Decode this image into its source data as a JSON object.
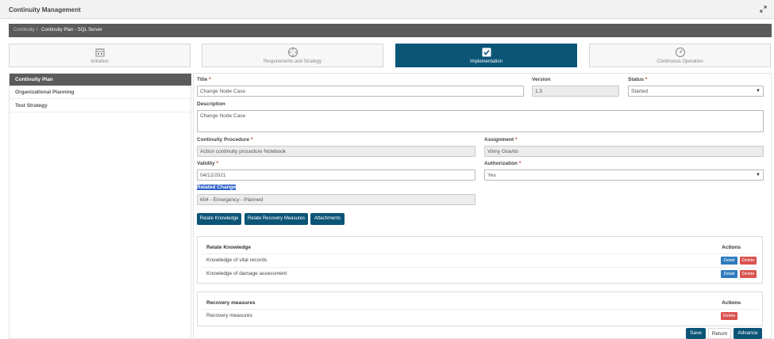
{
  "header": {
    "title": "Continuity Management"
  },
  "breadcrumb": {
    "parent": "Continuity",
    "separator": "/",
    "current": "Continuity Plan - SQL Server"
  },
  "steps": [
    {
      "label": "Initiation",
      "icon": "calendar-icon"
    },
    {
      "label": "Requirements and Strategy",
      "icon": "crosshair-icon"
    },
    {
      "label": "Implementation",
      "icon": "checkbox-icon",
      "active": true
    },
    {
      "label": "Continuous Operation",
      "icon": "gauge-icon"
    }
  ],
  "sidebar": {
    "items": [
      {
        "label": "Continuity Plan",
        "active": true
      },
      {
        "label": "Organizational Planning"
      },
      {
        "label": "Test Strategy"
      }
    ]
  },
  "form": {
    "title_label": "Title",
    "title_value": "Change Node Case",
    "version_label": "Version",
    "version_value": "1.3",
    "status_label": "Status",
    "status_value": "Started",
    "description_label": "Description",
    "description_value": "Change Node Case",
    "procedure_label": "Continuity Procedure",
    "procedure_value": "Action continuity procedure Notebook",
    "assignment_label": "Assignment",
    "assignment_value": "Vinny Gravito",
    "validity_label": "Validity",
    "validity_value": "04/12/2021",
    "authorization_label": "Authorization",
    "authorization_value": "Yes",
    "related_change_label": "Related Change",
    "related_change_value": "604 - Emergency - Planned",
    "required_mark": "*"
  },
  "buttons": {
    "relate_knowledge": "Relate Knowledge",
    "relate_recovery": "Relate Recovery Measures",
    "attachments": "Attachments"
  },
  "knowledge_panel": {
    "header": "Relate Knowledge",
    "actions_header": "Actions",
    "rows": [
      {
        "title": "Knowledge of vital records",
        "detail": "Detail",
        "delete": "Delete"
      },
      {
        "title": "Knowledge of damage assessment",
        "detail": "Detail",
        "delete": "Delete"
      }
    ]
  },
  "recovery_panel": {
    "header": "Recovery measures",
    "actions_header": "Actions",
    "rows": [
      {
        "title": "Recovery measures",
        "delete": "Delete"
      }
    ]
  },
  "footer": {
    "save": "Save",
    "return": "Return",
    "advance": "Advance"
  },
  "colors": {
    "primary": "#0b5577",
    "breadcrumb": "#5b5b5b",
    "danger": "#d9534f",
    "info": "#2f7bbd",
    "required": "#c0392b"
  }
}
